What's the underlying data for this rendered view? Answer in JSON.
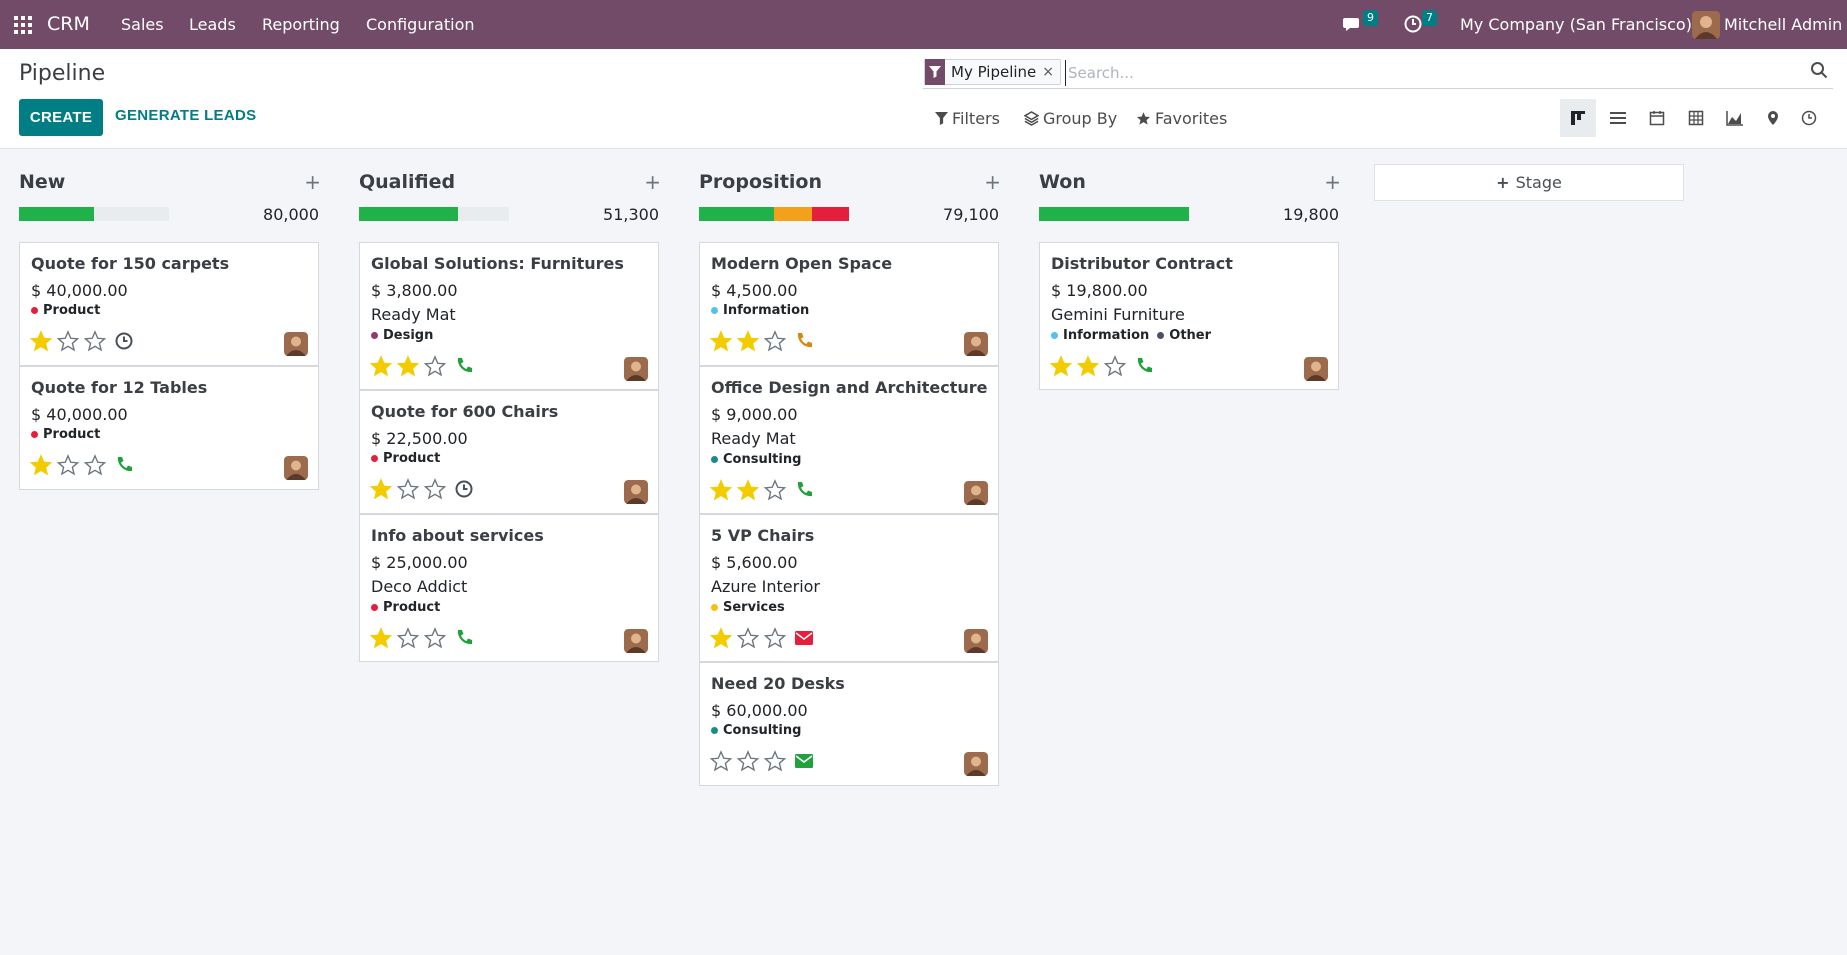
{
  "navbar": {
    "brand": "CRM",
    "menu": [
      "Sales",
      "Leads",
      "Reporting",
      "Configuration"
    ],
    "messages_count": "9",
    "activities_count": "7",
    "company": "My Company (San Francisco)",
    "user": "Mitchell Admin"
  },
  "control": {
    "title": "Pipeline",
    "create_label": "CREATE",
    "generate_label": "GENERATE LEADS",
    "facet": "My Pipeline",
    "facet_remove": "×",
    "search_placeholder": "Search...",
    "filters_label": "Filters",
    "groupby_label": "Group By",
    "favorites_label": "Favorites",
    "views": [
      "kanban",
      "list",
      "calendar",
      "pivot",
      "graph",
      "map",
      "activity"
    ]
  },
  "colors": {
    "navbar": "#714b67",
    "primary": "#017e84",
    "progress_green": "#21b14b",
    "progress_orange": "#f3a01c",
    "progress_red": "#e41f3b"
  },
  "add_stage_label": "Stage",
  "columns": [
    {
      "title": "New",
      "total": "80,000",
      "progress": [
        {
          "color": "#21b14b",
          "fraction": 0.5
        }
      ],
      "cards": [
        {
          "title": "Quote for 150 carpets",
          "amount": "$ 40,000.00",
          "partner": "",
          "tags": [
            {
              "label": "Product",
              "color": "#e41f3b"
            }
          ],
          "stars": 1,
          "activity": "clock-icon"
        },
        {
          "title": "Quote for 12 Tables",
          "amount": "$ 40,000.00",
          "partner": "",
          "tags": [
            {
              "label": "Product",
              "color": "#e41f3b"
            }
          ],
          "stars": 1,
          "activity": "phone-icon"
        }
      ]
    },
    {
      "title": "Qualified",
      "total": "51,300",
      "progress": [
        {
          "color": "#21b14b",
          "fraction": 0.66
        }
      ],
      "cards": [
        {
          "title": "Global Solutions: Furnitures",
          "amount": "$ 3,800.00",
          "partner": "Ready Mat",
          "tags": [
            {
              "label": "Design",
              "color": "#8e3a6f"
            }
          ],
          "stars": 2,
          "activity": "phone-icon"
        },
        {
          "title": "Quote for 600 Chairs",
          "amount": "$ 22,500.00",
          "partner": "",
          "tags": [
            {
              "label": "Product",
              "color": "#e41f3b"
            }
          ],
          "stars": 1,
          "activity": "clock-icon"
        },
        {
          "title": "Info about services",
          "amount": "$ 25,000.00",
          "partner": "Deco Addict",
          "tags": [
            {
              "label": "Product",
              "color": "#e41f3b"
            }
          ],
          "stars": 1,
          "activity": "phone-icon"
        }
      ]
    },
    {
      "title": "Proposition",
      "total": "79,100",
      "progress": [
        {
          "color": "#21b14b",
          "fraction": 0.5
        },
        {
          "color": "#f3a01c",
          "fraction": 0.25
        },
        {
          "color": "#e41f3b",
          "fraction": 0.25
        }
      ],
      "cards": [
        {
          "title": "Modern Open Space",
          "amount": "$ 4,500.00",
          "partner": "",
          "tags": [
            {
              "label": "Information",
              "color": "#4fc3e8"
            }
          ],
          "stars": 2,
          "activity": "phone-orange-icon"
        },
        {
          "title": "Office Design and Architecture",
          "amount": "$ 9,000.00",
          "partner": "Ready Mat",
          "tags": [
            {
              "label": "Consulting",
              "color": "#1a8a8a"
            }
          ],
          "stars": 2,
          "activity": "phone-icon"
        },
        {
          "title": "5 VP Chairs",
          "amount": "$ 5,600.00",
          "partner": "Azure Interior",
          "tags": [
            {
              "label": "Services",
              "color": "#f4c20d"
            }
          ],
          "stars": 1,
          "activity": "mail-red-icon"
        },
        {
          "title": "Need 20 Desks",
          "amount": "$ 60,000.00",
          "partner": "",
          "tags": [
            {
              "label": "Consulting",
              "color": "#1a8a8a"
            }
          ],
          "stars": 0,
          "activity": "mail-green-icon"
        }
      ]
    },
    {
      "title": "Won",
      "total": "19,800",
      "progress": [
        {
          "color": "#21b14b",
          "fraction": 1.0
        }
      ],
      "cards": [
        {
          "title": "Distributor Contract",
          "amount": "$ 19,800.00",
          "partner": "Gemini Furniture",
          "tags": [
            {
              "label": "Information",
              "color": "#4fc3e8"
            },
            {
              "label": "Other",
              "color": "#4a4f6a"
            }
          ],
          "stars": 2,
          "activity": "phone-icon"
        }
      ]
    }
  ]
}
